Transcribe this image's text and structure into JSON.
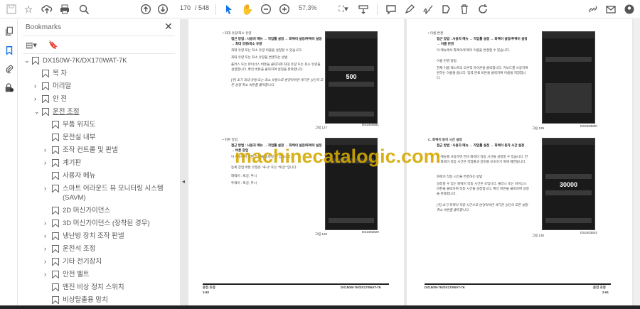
{
  "toolbar": {
    "page_current": "170",
    "page_total": "/ 548",
    "zoom": "57.3%",
    "icons": [
      "save-icon",
      "star-icon",
      "cloud-upload-icon",
      "print-icon",
      "zoom-search-icon",
      "page-up-icon",
      "page-down-icon",
      "select-cursor-icon",
      "hand-icon",
      "zoom-out-icon",
      "zoom-in-icon",
      "fit-page-icon",
      "scroll-mode-icon",
      "comment-icon",
      "highlight-icon",
      "sign-icon",
      "stamp-icon",
      "delete-icon",
      "rotate-icon",
      "share-link-icon",
      "email-icon",
      "account-icon"
    ]
  },
  "panel": {
    "title": "Bookmarks",
    "close": "✕",
    "bookmarks": [
      {
        "label": "DX150W-7K/DX170WAT-7K",
        "level": 0,
        "chev": "⌄"
      },
      {
        "label": "목 차",
        "level": 1,
        "chev": ""
      },
      {
        "label": "머리말",
        "level": 1,
        "chev": "›"
      },
      {
        "label": "안 전",
        "level": 1,
        "chev": "›"
      },
      {
        "label": "운전 조정",
        "level": 1,
        "chev": "⌄"
      },
      {
        "label": "부품 위치도",
        "level": 2,
        "chev": ""
      },
      {
        "label": "운전실 내부",
        "level": 2,
        "chev": ""
      },
      {
        "label": "조작 컨트롤 및 판넬",
        "level": 2,
        "chev": "›"
      },
      {
        "label": "계기판",
        "level": 2,
        "chev": "›"
      },
      {
        "label": "사용자 메뉴",
        "level": 2,
        "chev": ""
      },
      {
        "label": "스마트 어라운드 뷰 모니터링 시스템",
        "label2": "(SAVM)",
        "level": 2,
        "chev": "›"
      },
      {
        "label": "2D 머신가이던스",
        "level": 2,
        "chev": ""
      },
      {
        "label": "3D 머신가이던스 (장착된 경우)",
        "level": 2,
        "chev": "›"
      },
      {
        "label": "냉난방 장치 조작 판넬",
        "level": 2,
        "chev": "›"
      },
      {
        "label": "운전석 조정",
        "level": 2,
        "chev": "›"
      },
      {
        "label": "기타 전기장치",
        "level": 2,
        "chev": "›"
      },
      {
        "label": "안전 벨트",
        "level": 2,
        "chev": "›"
      },
      {
        "label": "엔진 비상 정지 스위치",
        "level": 2,
        "chev": ""
      },
      {
        "label": "비상탈출용 망치",
        "level": 2,
        "chev": ""
      }
    ]
  },
  "left_page": {
    "s1_title": "•   최대 유량/최소 유량",
    "s1_access": "접근 방법 : 사용자 메뉴 → 작업툴 설정 → 화렉이 설정/투렉이 설정 → 최대 유량/최소 유량",
    "s1_p1": "최대 유량 또는 최소 유량 비율을 설정할 수 있습니다.",
    "s1_p2": "최대 유량 또는 최소 유량을 변경하는 방법",
    "s1_p3": "플러스 또는 마이너스 버튼을 클릭하여 최대 유량 또는 최소 유량을 설정합니다. 확인 버튼을 클릭하여 설정을 완료합니다.",
    "s1_note": "[주] 초기 최대 유량 또는 최소 유량으로 변경하려면 계기판 상단의 모든 설정 취소 버튼을 클릭합니다.",
    "fig1_value": "500",
    "fig1_caption": "그림 127",
    "fig1_code": "DS2403881",
    "s2_title": "•   버튼 장업",
    "s2_access": "접근 방법 : 사용자 메뉴 → 작업툴 설정 → 화렉이 설정/투렉이 설정 → 버튼 장업",
    "s2_p1": "이 메뉴에서 버튼 유형을 설정할 수 있습니다.",
    "s2_p2": "등록 장업 버튼 유형은 \"푸시\" 또는 \"토글\" 입니다.",
    "s2_p3": "화렉이 : 토글, 푸시",
    "s2_p4": "투렉이 : 토글, 푸시",
    "fig2_caption": "그림 128",
    "fig2_code": "DS2403829",
    "footer_section": "운전 조정",
    "footer_page": "2-60",
    "footer_model": "DX150W-7K/DX170WAT-7K"
  },
  "right_page": {
    "s1_title": "•   이름 변경",
    "s1_access": "접근 방법 : 사용자 메뉴 → 작업툴 설정 → 화렉이 설정/투렉이 설정 → 이름 변경",
    "s1_p1": "이 메뉴에서 화렉이/투렉이 이름을 변경할 수 있습니다.",
    "s1_p2": "이름 변경 방법",
    "s1_p3": "현재 이름 텍스트의 오른쪽 아이콘을 클릭합니다. 키보드를 사용하여 원하는 이름을 씁니다. 입력 완료 버튼을 클릭하여 이름을 저장합니다.",
    "fig1_caption": "그림 129",
    "fig1_code": "DS2403830",
    "s2_title": "C.   화렉이 동작 시간 설정",
    "s2_access": "접근 방법 : 사용자 메뉴 → 작업툴 설정 → 화렉이 동작 시간 설정",
    "s2_p1": "이 메뉴를 사용하면 연비 화렉이 작동 시간을 설정할 수 있습니다. 연비 화렉이 작동 시간은 작업툴과 장비를 보호하기 위해 제한됩니다.",
    "s2_p2": "화렉이 작동 시간을 변경하는 방법",
    "s2_p3": "설정할 수 있는 화렉이 작동 시간은 초입니다. 플러스 또는 마이너스 버튼을 클릭하여 작동 시간을 설정합니다. 확인 버튼을 클릭하여 설정을 완료합니다.",
    "s2_note": "[주] 초기 화렉이 작동 시간으로 변경하려면 계기판 상단의 모든 설정 취소 버튼을 클릭합니다.",
    "fig2_value": "30000",
    "fig2_caption": "그림 130",
    "fig2_code": "DS2403824",
    "footer_section": "운전 조정",
    "footer_page": "2-61",
    "footer_model": "DX150W-7K/DX170WAT-7K"
  },
  "watermark": "machinecatalogic.com",
  "colors": {
    "accent": "#1473e6",
    "watermark": "#d4a800"
  }
}
